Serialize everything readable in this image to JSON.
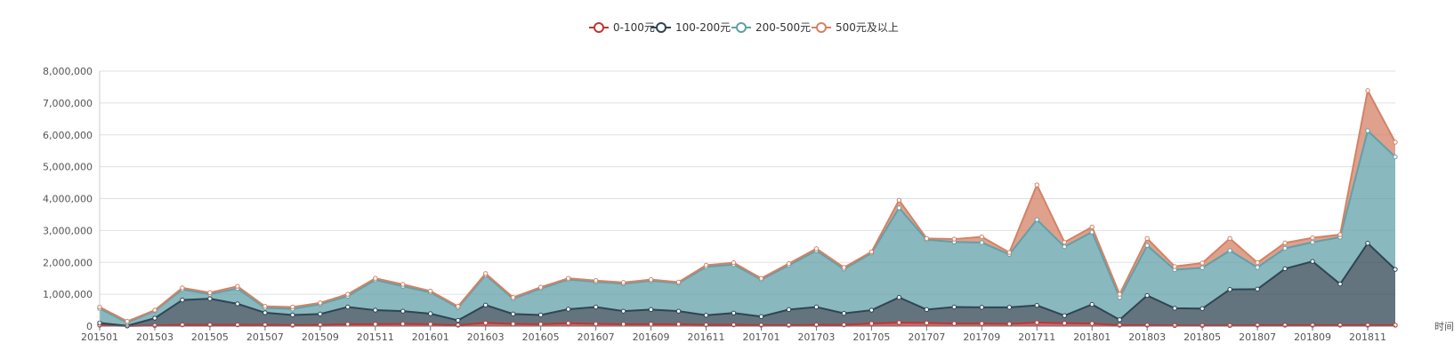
{
  "chart_data": {
    "type": "area",
    "stacked": true,
    "xlabel": "时间",
    "ylabel": "",
    "ylim": [
      0,
      8000000
    ],
    "yticks": [
      0,
      1000000,
      2000000,
      3000000,
      4000000,
      5000000,
      6000000,
      7000000,
      8000000
    ],
    "ytick_labels": [
      "0",
      "1,000,000",
      "2,000,000",
      "3,000,000",
      "4,000,000",
      "5,000,000",
      "6,000,000",
      "7,000,000",
      "8,000,000"
    ],
    "xtick_labels": [
      "201501",
      "201503",
      "201505",
      "201507",
      "201509",
      "201511",
      "201601",
      "201603",
      "201605",
      "201607",
      "201609",
      "201611",
      "201701",
      "201703",
      "201705",
      "201707",
      "201709",
      "201711",
      "201801",
      "201803",
      "201805",
      "201807",
      "201809",
      "201811"
    ],
    "grid": true,
    "legend_position": "top-center",
    "categories": [
      "201501",
      "201502",
      "201503",
      "201504",
      "201505",
      "201506",
      "201507",
      "201508",
      "201509",
      "201510",
      "201511",
      "201512",
      "201601",
      "201602",
      "201603",
      "201604",
      "201605",
      "201606",
      "201607",
      "201608",
      "201609",
      "201610",
      "201611",
      "201612",
      "201701",
      "201702",
      "201703",
      "201704",
      "201705",
      "201706",
      "201707",
      "201708",
      "201709",
      "201710",
      "201711",
      "201712",
      "201801",
      "201802",
      "201803",
      "201804",
      "201805",
      "201806",
      "201807",
      "201808",
      "201809",
      "201810",
      "201811",
      "201812"
    ],
    "series": [
      {
        "name": "0-100元",
        "color": "#c23531",
        "values": [
          30000,
          5000,
          20000,
          40000,
          40000,
          40000,
          40000,
          30000,
          40000,
          60000,
          60000,
          70000,
          60000,
          30000,
          100000,
          70000,
          60000,
          90000,
          70000,
          60000,
          60000,
          60000,
          40000,
          40000,
          30000,
          30000,
          40000,
          40000,
          80000,
          110000,
          100000,
          80000,
          80000,
          70000,
          110000,
          90000,
          80000,
          30000,
          30000,
          20000,
          20000,
          20000,
          30000,
          30000,
          30000,
          30000,
          30000,
          30000
        ]
      },
      {
        "name": "100-200元",
        "color": "#2f4554",
        "values": [
          70000,
          5000,
          230000,
          780000,
          820000,
          660000,
          380000,
          320000,
          340000,
          540000,
          440000,
          400000,
          330000,
          150000,
          560000,
          310000,
          290000,
          440000,
          530000,
          410000,
          460000,
          410000,
          300000,
          370000,
          270000,
          490000,
          560000,
          360000,
          420000,
          790000,
          420000,
          520000,
          510000,
          520000,
          540000,
          240000,
          600000,
          170000,
          930000,
          540000,
          530000,
          1130000,
          1130000,
          1770000,
          2000000,
          1290000,
          2570000,
          1750000
        ]
      },
      {
        "name": "200-500元",
        "color": "#61a0a8",
        "values": [
          450000,
          100000,
          230000,
          330000,
          140000,
          480000,
          150000,
          190000,
          310000,
          340000,
          950000,
          780000,
          670000,
          400000,
          940000,
          480000,
          830000,
          930000,
          790000,
          860000,
          900000,
          880000,
          1520000,
          1520000,
          1160000,
          1390000,
          1770000,
          1390000,
          1790000,
          2810000,
          2190000,
          2040000,
          2030000,
          1660000,
          2690000,
          2160000,
          2270000,
          700000,
          1570000,
          1210000,
          1280000,
          1220000,
          680000,
          640000,
          600000,
          1470000,
          3530000,
          3530000
        ]
      },
      {
        "name": "500元及以上",
        "color": "#d48265",
        "values": [
          50000,
          40000,
          20000,
          50000,
          50000,
          70000,
          50000,
          60000,
          40000,
          60000,
          50000,
          60000,
          40000,
          40000,
          50000,
          40000,
          40000,
          40000,
          40000,
          40000,
          40000,
          30000,
          50000,
          60000,
          40000,
          50000,
          60000,
          50000,
          40000,
          240000,
          40000,
          90000,
          180000,
          60000,
          1090000,
          140000,
          160000,
          100000,
          220000,
          100000,
          150000,
          380000,
          150000,
          170000,
          140000,
          80000,
          1260000,
          460000
        ]
      }
    ]
  }
}
